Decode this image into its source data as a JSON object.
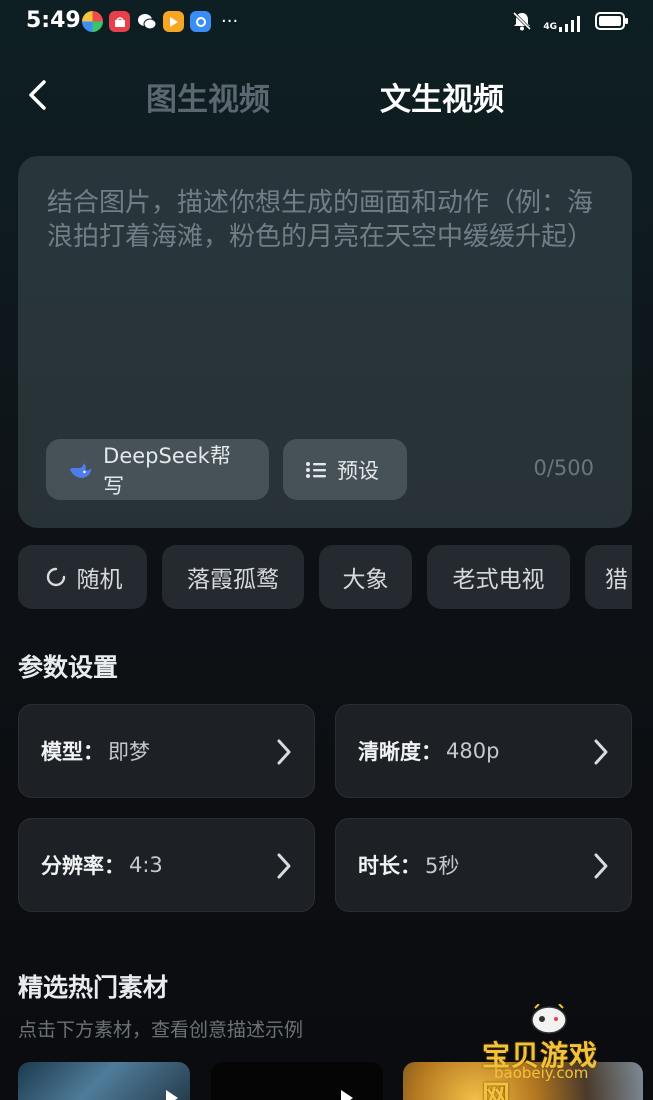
{
  "status_bar": {
    "time": "5:49",
    "more": "···",
    "network": "4G",
    "icons": [
      "colorful-app-icon",
      "huawei-store-icon",
      "wechat-icon",
      "video-app-icon",
      "browser-app-icon",
      "mute-bell-icon",
      "signal-icon",
      "battery-icon"
    ]
  },
  "header": {
    "tabs": [
      {
        "label": "图生视频",
        "active": false
      },
      {
        "label": "文生视频",
        "active": true
      }
    ]
  },
  "prompt": {
    "placeholder": "结合图片，描述你想生成的画面和动作（例：海浪拍打着海滩，粉色的月亮在天空中缓缓升起）",
    "deepseek_label": "DeepSeek帮写",
    "preset_label": "预设",
    "char_count": "0/500"
  },
  "chips": [
    "随机",
    "落霞孤鹜",
    "大象",
    "老式电视",
    "猎"
  ],
  "params": {
    "title": "参数设置",
    "items": [
      {
        "label": "模型：",
        "value": "即梦"
      },
      {
        "label": "清晰度：",
        "value": "480p"
      },
      {
        "label": "分辨率：",
        "value": "4:3"
      },
      {
        "label": "时长：",
        "value": "5秒"
      }
    ]
  },
  "materials": {
    "title": "精选热门素材",
    "subtitle": "点击下方素材，查看创意描述示例"
  },
  "watermark": {
    "text": "宝贝游戏网",
    "url": "baobeiy.com"
  },
  "colors": {
    "accent_blue": "#4f7df0",
    "text_muted": "#727e85",
    "card_bg": "#1d2126",
    "watermark_gold": "#f3c23a"
  }
}
